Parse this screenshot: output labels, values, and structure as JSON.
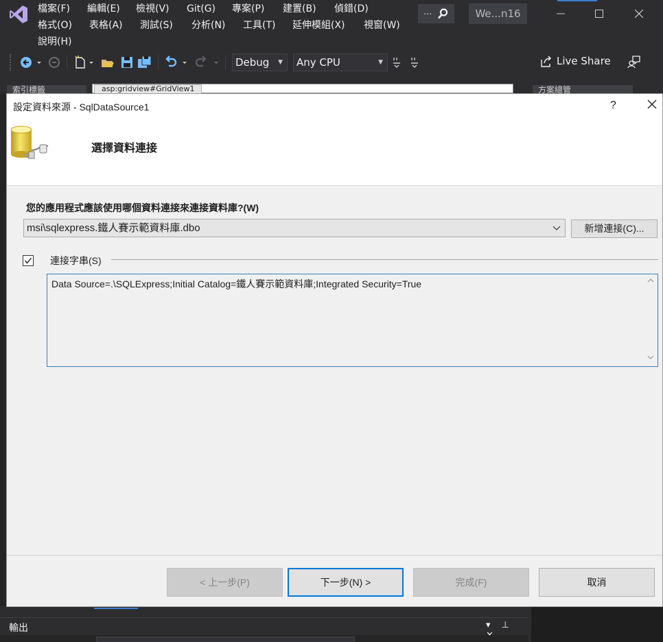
{
  "ide": {
    "menu": {
      "row1": [
        "檔案(F)",
        "編輯(E)",
        "檢視(V)",
        "Git(G)",
        "專案(P)",
        "建置(B)",
        "偵錯(D)"
      ],
      "row2": [
        "格式(O)",
        "表格(A)",
        "測試(S)",
        "分析(N)",
        "工具(T)",
        "延伸模組(X)",
        "視窗(W)"
      ],
      "row3": [
        "說明(H)"
      ]
    },
    "search_dots": "...",
    "project_name": "We...n16",
    "toolbar": {
      "config": "Debug",
      "platform": "Any CPU",
      "live_share": "Live Share"
    },
    "doc_tabs": {
      "left_tab": "索引標籤",
      "right_tab": "方案總管",
      "address": "asp:gridview#GridView1"
    },
    "output_panel": {
      "title": "輸出",
      "controls": "▾ ⊥ ✕"
    },
    "accent_color": "#3d7fd1"
  },
  "dialog": {
    "title": "設定資料來源 - SqlDataSource1",
    "help": "?",
    "step_title": "選擇資料連接",
    "question": "您的應用程式應該使用哪個資料連接來連接資料庫?(W)",
    "selected_connection": "msi\\sqlexpress.鐵人賽示範資料庫.dbo",
    "new_connection_button": "新增連接(C)...",
    "connection_string_checked": true,
    "connection_string_label": "連接字串(S)",
    "connection_string": "Data Source=.\\SQLExpress;Initial Catalog=鐵人賽示範資料庫;Integrated Security=True",
    "buttons": {
      "previous": "< 上一步(P)",
      "next": "下一步(N) >",
      "finish": "完成(F)",
      "cancel": "取消"
    }
  }
}
